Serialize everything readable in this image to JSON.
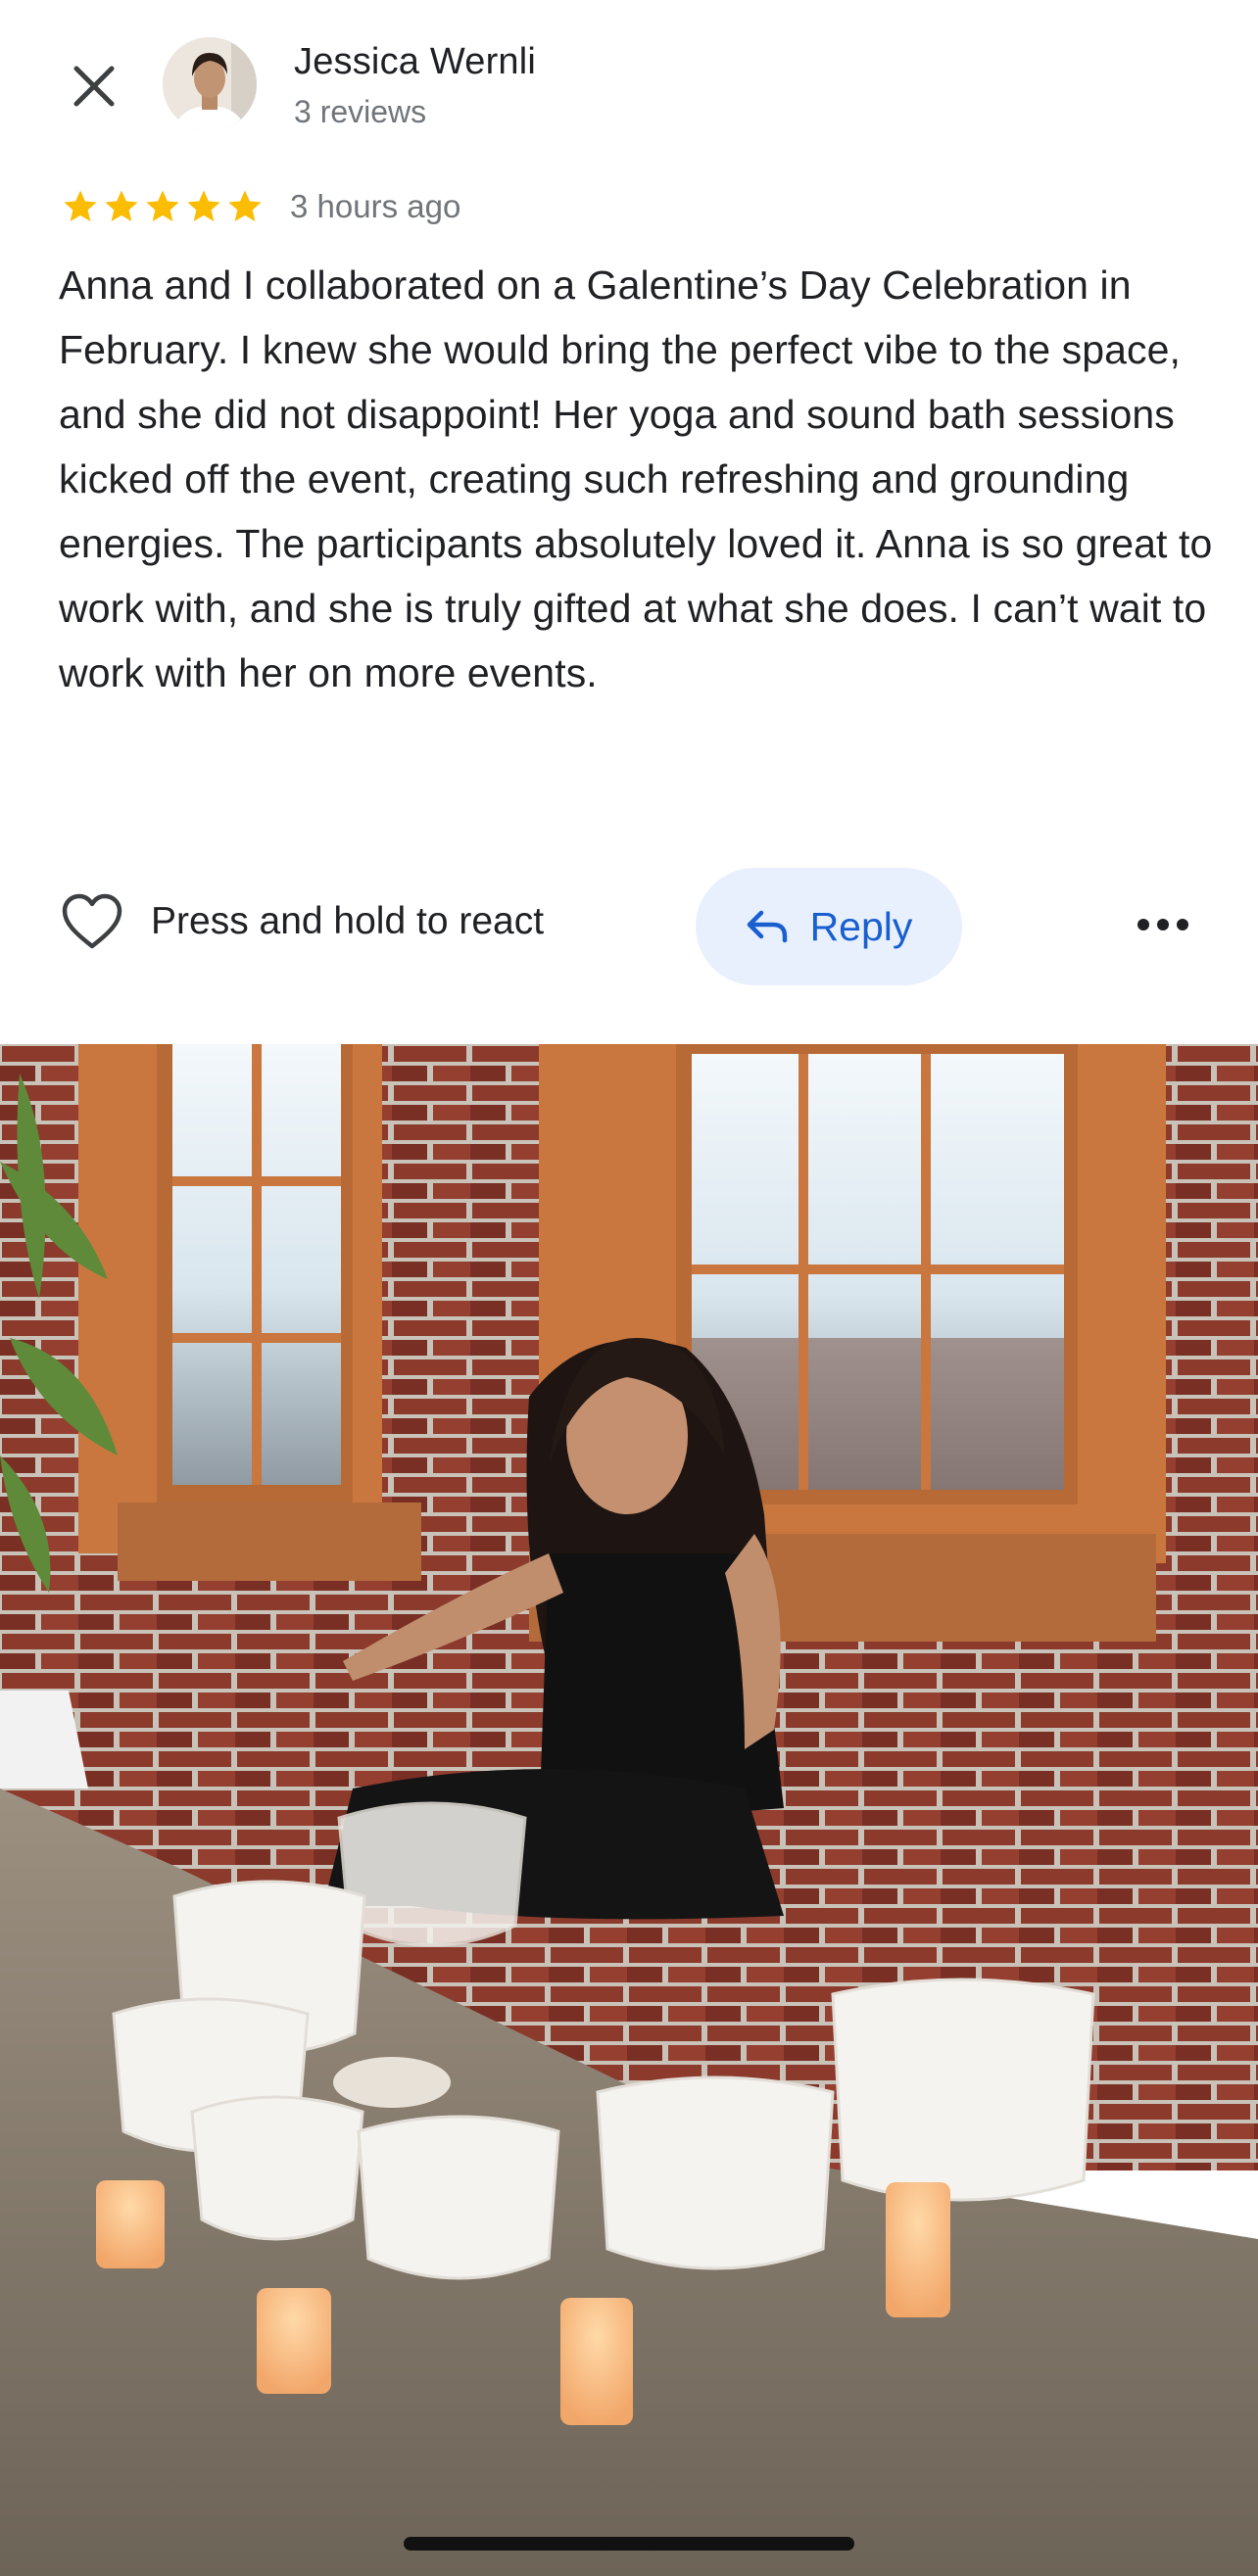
{
  "header": {
    "reviewer_name": "Jessica Wernli",
    "reviewer_sub": "3 reviews"
  },
  "review": {
    "rating": 5,
    "max_rating": 5,
    "time_ago": "3 hours ago",
    "text": "Anna and I collaborated on a Galentine’s Day Celebration in February. I knew she would bring the perfect vibe to the space, and she did not disappoint! Her yoga and sound bath sessions kicked off the event, creating such refreshing and grounding energies. The participants absolutely loved it. Anna is so great to work with, and she is truly gifted at what she does. I can’t wait to work with her on more events."
  },
  "actions": {
    "react_label": "Press and hold to react",
    "reply_label": "Reply"
  },
  "icons": {
    "close": "close-icon",
    "heart": "heart-icon",
    "reply": "reply-arrow-icon",
    "more": "more-horizontal-icon",
    "star": "star-icon"
  },
  "colors": {
    "star": "#fbbc04",
    "reply_bg": "#e8f0fe",
    "reply_text": "#1a5fd0",
    "secondary_text": "#70757a"
  }
}
